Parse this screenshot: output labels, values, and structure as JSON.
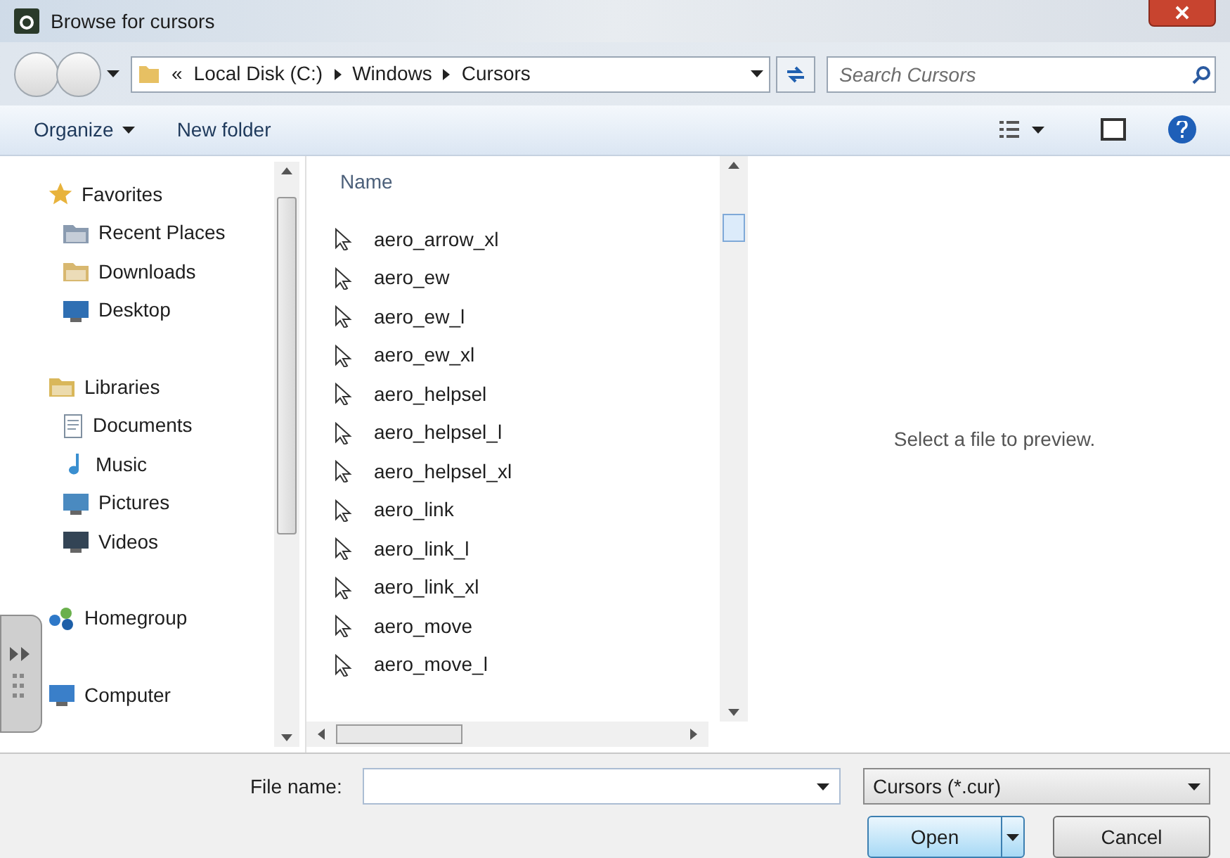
{
  "window": {
    "title": "Browse for cursors"
  },
  "address": {
    "overflow": "«",
    "crumbs": [
      "Local Disk (C:)",
      "Windows",
      "Cursors"
    ]
  },
  "search": {
    "placeholder": "Search Cursors"
  },
  "toolbar": {
    "buttons": [
      "Organize",
      "New folder"
    ]
  },
  "navigation": [
    {
      "label": "Favorites",
      "kind": "favorites",
      "children": [
        {
          "label": "Recent Places",
          "kind": "recent"
        },
        {
          "label": "Downloads",
          "kind": "downloads"
        },
        {
          "label": "Desktop",
          "kind": "desktop"
        }
      ]
    },
    {
      "label": "Libraries",
      "kind": "libraries",
      "children": [
        {
          "label": "Documents",
          "kind": "documents"
        },
        {
          "label": "Music",
          "kind": "music"
        },
        {
          "label": "Pictures",
          "kind": "pictures"
        },
        {
          "label": "Videos",
          "kind": "videos"
        }
      ]
    },
    {
      "label": "Homegroup",
      "kind": "homegroup"
    },
    {
      "label": "Computer",
      "kind": "computer"
    }
  ],
  "file_list": {
    "column": "Name",
    "files": [
      "aero_arrow_xl",
      "aero_ew",
      "aero_ew_l",
      "aero_ew_xl",
      "aero_helpsel",
      "aero_helpsel_l",
      "aero_helpsel_xl",
      "aero_link",
      "aero_link_l",
      "aero_link_xl",
      "aero_move",
      "aero_move_l"
    ]
  },
  "preview": {
    "message": "Select a file to preview."
  },
  "file_name": {
    "label": "File name:"
  },
  "file_type": {
    "value": "Cursors (*.cur)"
  },
  "buttons": {
    "open": "Open",
    "cancel": "Cancel"
  }
}
